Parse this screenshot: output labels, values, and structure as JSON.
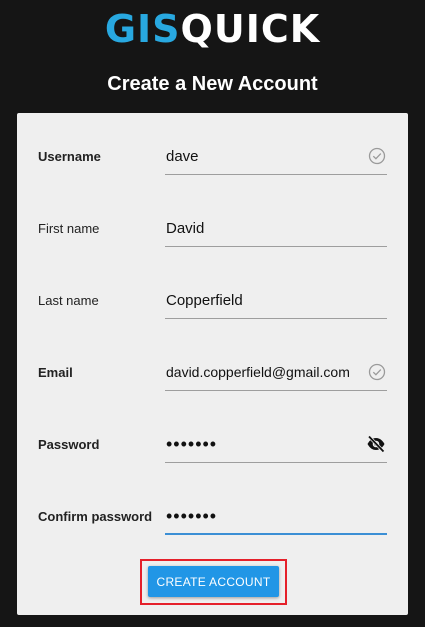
{
  "brand": {
    "part1": "GIS",
    "part2": "QUICK"
  },
  "page": {
    "title": "Create a New Account"
  },
  "form": {
    "username": {
      "label": "Username",
      "value": "dave",
      "valid": true
    },
    "first_name": {
      "label": "First name",
      "value": "David"
    },
    "last_name": {
      "label": "Last name",
      "value": "Copperfield"
    },
    "email": {
      "label": "Email",
      "value": "david.copperfield@gmail.com",
      "valid": true
    },
    "password": {
      "label": "Password",
      "value": "•••••••"
    },
    "confirm_password": {
      "label": "Confirm password",
      "value": "•••••••",
      "focused": true
    }
  },
  "actions": {
    "create_label": "CREATE ACCOUNT"
  },
  "icons": {
    "valid": "check-circle-icon",
    "password_visibility": "eye-off-icon"
  },
  "colors": {
    "background": "#151515",
    "brand_accent": "#28a8e0",
    "primary_button": "#2196e6",
    "focus_underline": "#3b8fd5",
    "highlight_box": "#e5202a",
    "card": "#efefef"
  }
}
